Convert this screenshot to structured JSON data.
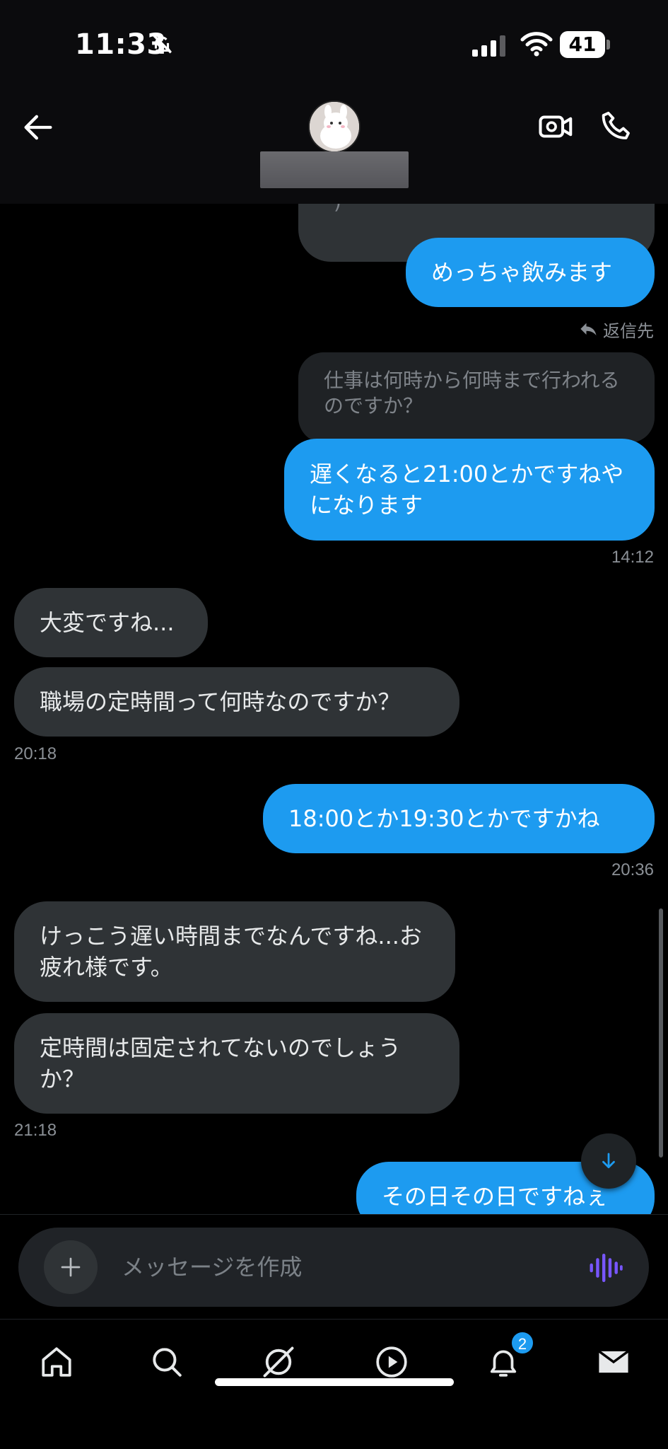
{
  "status_bar": {
    "time": "11:33",
    "battery": "41"
  },
  "header": {
    "back_label": "back",
    "video_label": "video call",
    "call_label": "voice call"
  },
  "messages": [
    {
      "id": "m0",
      "dir": "in",
      "text": "熱酒は飲めないんですよね(´･ω･`)"
    },
    {
      "id": "m1",
      "dir": "out",
      "text": "めっちゃ飲みます"
    },
    {
      "id": "m2",
      "dir": "quote",
      "text": "仕事は何時から何時まで行われるのですか？"
    },
    {
      "id": "m3",
      "dir": "out",
      "text": "遅くなると21:00とかですねやになります"
    },
    {
      "id": "m4",
      "dir": "in",
      "text": "大変ですね..."
    },
    {
      "id": "m5",
      "dir": "in",
      "text": "職場の定時間って何時なのですか？"
    },
    {
      "id": "m6",
      "dir": "out",
      "text": "18:00とか19:30とかですかね"
    },
    {
      "id": "m7",
      "dir": "in",
      "text": "けっこう遅い時間までなんですね...お疲れ様です。"
    },
    {
      "id": "m8",
      "dir": "in",
      "text": "定時間は固定されてないのでしょうか？"
    },
    {
      "id": "m9",
      "dir": "out",
      "text": "その日その日ですねぇ"
    }
  ],
  "reply_label": "返信先",
  "timestamps": {
    "t1": "14:12",
    "t2": "20:18",
    "t3": "20:36",
    "t4": "21:18"
  },
  "composer": {
    "placeholder": "メッセージを作成"
  },
  "nav": {
    "notification_badge": "2"
  },
  "colors": {
    "accent": "#1d9bf0",
    "incoming_bubble": "#2f3336",
    "voice_icon": "#7856ff"
  }
}
